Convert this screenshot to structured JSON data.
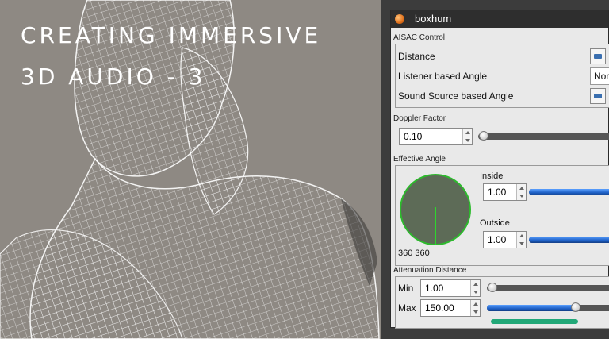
{
  "hero": {
    "title_line1": "CREATING IMMERSIVE",
    "title_line2": "3D AUDIO - 3"
  },
  "panel": {
    "header_title": "boxhum",
    "aisac": {
      "section_label": "AISAC Control",
      "distance_label": "Distance",
      "listener_label": "Listener based Angle",
      "listener_value": "Non",
      "source_label": "Sound Source based Angle"
    },
    "doppler": {
      "section_label": "Doppler Factor",
      "value": "0.10",
      "slider_fraction": 0.02
    },
    "angle": {
      "section_label": "Effective Angle",
      "readout": "360 360",
      "inside_label": "Inside",
      "inside_value": "1.00",
      "outside_label": "Outside",
      "outside_value": "1.00"
    },
    "attenuation": {
      "section_label": "Attenuation Distance",
      "min_label": "Min",
      "min_value": "1.00",
      "max_label": "Max",
      "max_value": "150.00"
    }
  },
  "colors": {
    "panel_bg": "#e9e9e9",
    "header_bg": "#2e2e2e",
    "accent_blue": "#1d5fc4",
    "angle_green": "#2dba2d",
    "range_green": "#22a878"
  }
}
